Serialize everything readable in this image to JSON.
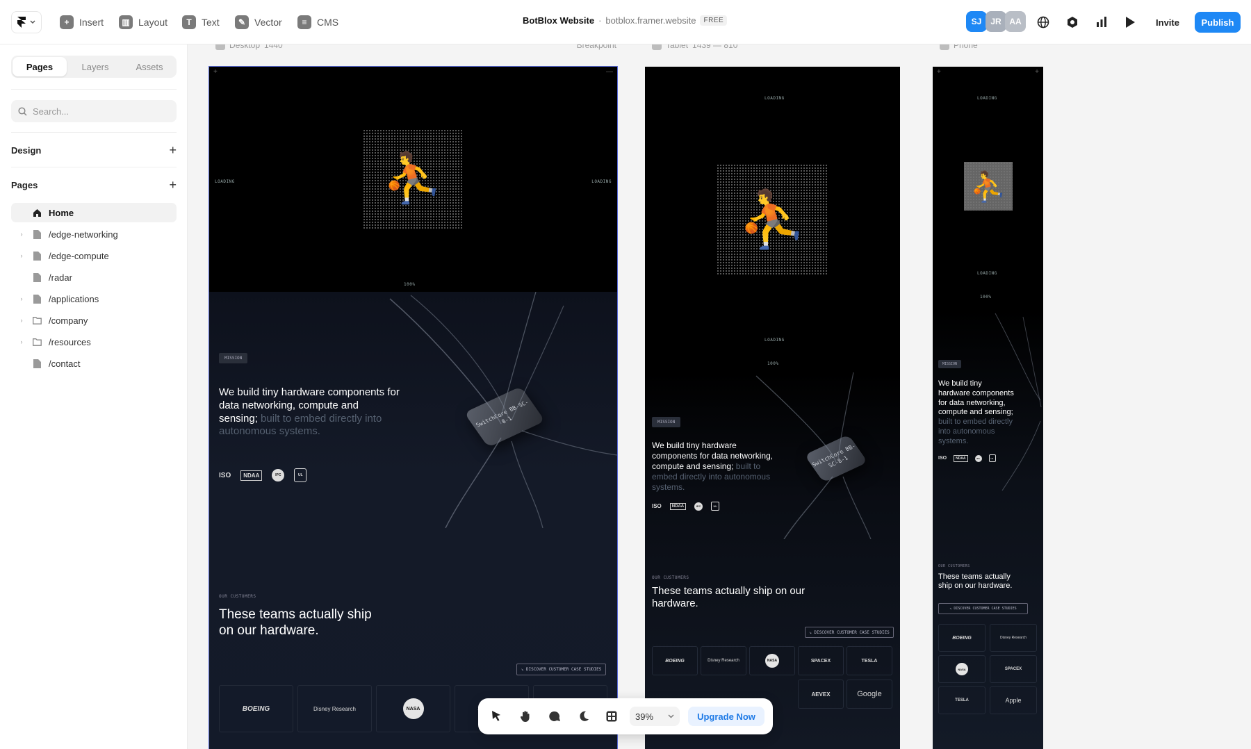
{
  "topbar": {
    "tools": [
      {
        "label": "Insert",
        "icon": "plus-square-icon"
      },
      {
        "label": "Layout",
        "icon": "layout-icon"
      },
      {
        "label": "Text",
        "icon": "text-icon"
      },
      {
        "label": "Vector",
        "icon": "pen-icon"
      },
      {
        "label": "CMS",
        "icon": "database-icon"
      }
    ],
    "site_name": "BotBlox Website",
    "site_domain": "botblox.framer.website",
    "plan": "FREE",
    "avatars": [
      {
        "initials": "SJ",
        "color": "#1e88f5"
      },
      {
        "initials": "JR",
        "color": "#a9b0bb"
      },
      {
        "initials": "AA",
        "color": "#b9bec6"
      }
    ],
    "invite_label": "Invite",
    "publish_label": "Publish"
  },
  "sidebar": {
    "tabs": [
      "Pages",
      "Layers",
      "Assets"
    ],
    "active_tab": "Pages",
    "search_placeholder": "Search...",
    "design_label": "Design",
    "pages_label": "Pages",
    "pages": [
      {
        "label": "Home",
        "icon": "home-icon",
        "active": true,
        "expandable": false
      },
      {
        "label": "/edge-networking",
        "icon": "page-icon",
        "expandable": true
      },
      {
        "label": "/edge-compute",
        "icon": "page-icon",
        "expandable": true
      },
      {
        "label": "/radar",
        "icon": "page-icon",
        "expandable": false
      },
      {
        "label": "/applications",
        "icon": "page-icon",
        "expandable": true
      },
      {
        "label": "/company",
        "icon": "folder-icon",
        "expandable": true
      },
      {
        "label": "/resources",
        "icon": "folder-icon",
        "expandable": true
      },
      {
        "label": "/contact",
        "icon": "page-icon",
        "expandable": false
      }
    ]
  },
  "canvas": {
    "frames": [
      {
        "name": "Desktop",
        "width_label": "1440",
        "extra": "Breakpoint"
      },
      {
        "name": "Tablet",
        "width_label": "1439 — 810",
        "extra": ""
      },
      {
        "name": "Phone",
        "width_label": "",
        "extra": ""
      }
    ],
    "site": {
      "loading": "LOADING",
      "percent": "100%",
      "mission_tag": "MISSION",
      "mission_text_bright": "We build tiny hardware components for data networking, compute and sensing;",
      "mission_text_dim": "built to embed directly into autonomous systems.",
      "chip_text": "SwitchCore BB-SC-8-1",
      "badges": [
        "ISO",
        "NDAA",
        "IPC",
        "UL"
      ],
      "customers_label": "OUR CUSTOMERS",
      "customers_title": "These teams actually ship on our hardware.",
      "discover_label": "↘ DISCOVER CUSTOMER CASE STUDIES",
      "logos": [
        "BOEING",
        "Disney Research",
        "NASA",
        "SPACEX",
        "TESLA",
        "AEVEX",
        "Google",
        "Apple"
      ]
    }
  },
  "floating_toolbar": {
    "tools": [
      "pointer-icon",
      "hand-icon",
      "comment-icon",
      "moon-icon",
      "grid-icon"
    ],
    "zoom": "39%",
    "upgrade_label": "Upgrade Now"
  },
  "colors": {
    "accent": "#1e88f5",
    "canvas_bg": "#f4f4f4",
    "site_navy": "#131a29"
  }
}
